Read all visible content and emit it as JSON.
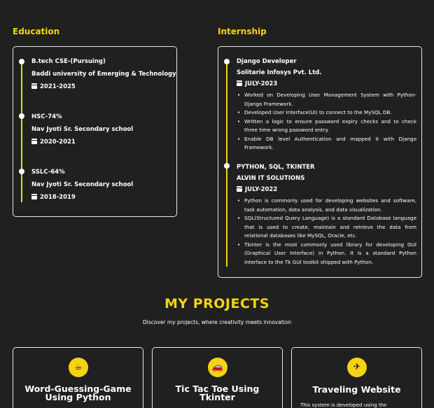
{
  "education": {
    "title": "Education",
    "entries": [
      {
        "line1": "B.tech CSE-(Pursuing)",
        "line2": "Baddi university of Emerging & Technology",
        "date": "2021-2025"
      },
      {
        "line1": "HSC-74%",
        "line2": "Nav Jyoti Sr. Secondary school",
        "date": "2020-2021"
      },
      {
        "line1": "SSLC-64%",
        "line2": "Nav Jyoti Sr. Secondary school",
        "date": "2018-2019"
      }
    ]
  },
  "internship": {
    "title": "Internship",
    "entries": [
      {
        "role": "Django Developer",
        "company": "Solitarie Infosys Pvt. Ltd.",
        "date": "JULY-2023",
        "bullets": [
          "Worked on Developing User Management System with Python-Django Framework.",
          "Developed User Interface(UI) to connect to the MySQL DB.",
          "Written a logic to ensure password expiry checks and to check three time wrong password entry.",
          "Enable DB level Authentication and mapped it with Django Framework."
        ]
      },
      {
        "role": "PYTHON, SQL, TKINTER",
        "company": "ALVIN IT SOLUTIONS",
        "date": "JULY-2022",
        "bullets": [
          "Python is commonly used for developing websites and software, task automation, data analysis, and data visualization.",
          "SQL(Structured Query Language) is a standard Database language that is used to create, maintain and retrieve the data from relational databases like MySQL, Oracle, etc.",
          "Tkinter is the most commonly used library for developing GUI (Graphical User Interface) in Python. It is a standard Python interface to the Tk GUI toolkit shipped with Python."
        ]
      }
    ]
  },
  "projects": {
    "title": "MY PROJECTS",
    "subtitle": "Discover my projects, where creativity meets innovation",
    "items": [
      {
        "icon": "coffee-icon",
        "title": "Word-Guessing-Game Using Python",
        "desc": ""
      },
      {
        "icon": "car-icon",
        "title": "Tic Tac Toe Using Tkinter",
        "desc": ""
      },
      {
        "icon": "plane-icon",
        "title": "Traveling Website",
        "desc": "This system is developed using the"
      }
    ]
  },
  "colors": {
    "accent": "#f5d312",
    "background": "#202020",
    "text": "#ffffff"
  }
}
